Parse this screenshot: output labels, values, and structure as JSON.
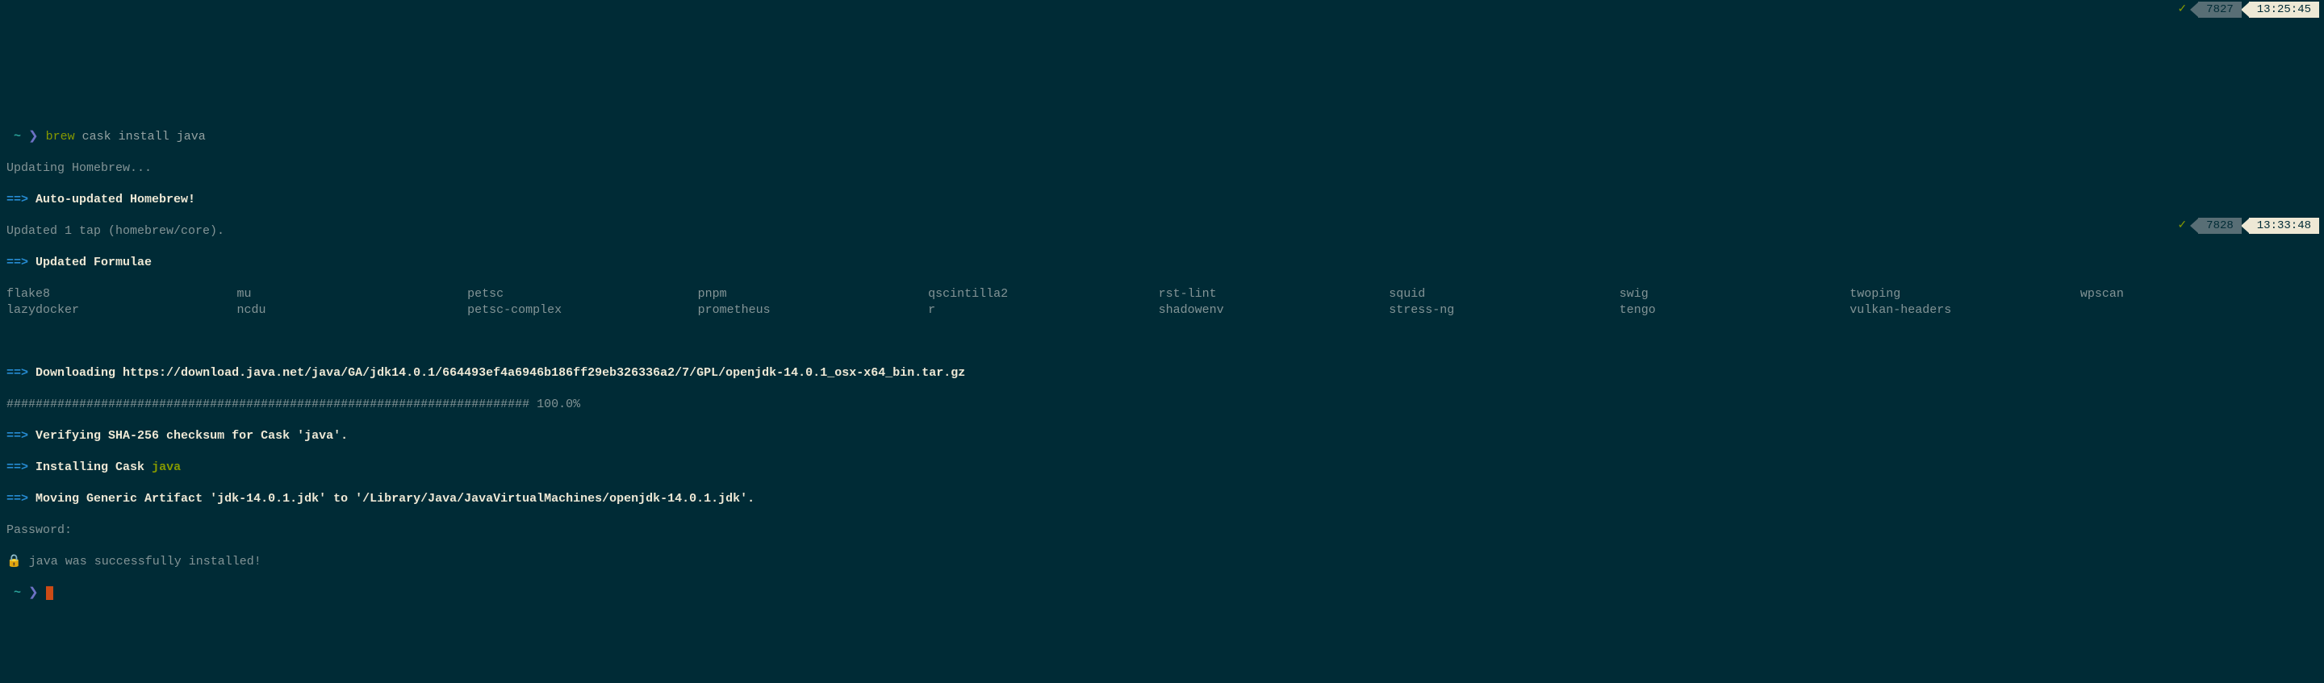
{
  "status_bars": [
    {
      "check": "✓",
      "num": "7827",
      "time": "13:25:45"
    },
    {
      "check": "✓",
      "num": "7828",
      "time": "13:33:48"
    }
  ],
  "prompt1": {
    "tilde": "~",
    "arrow": "❯",
    "cmd_green": "brew",
    "cmd_rest": "cask install java"
  },
  "lines": {
    "updating": "Updating Homebrew...",
    "arrow": "==>",
    "auto_updated": "Auto-updated Homebrew!",
    "updated_tap": "Updated 1 tap (homebrew/core).",
    "updated_formulae": "Updated Formulae",
    "downloading": "Downloading https://download.java.net/java/GA/jdk14.0.1/664493ef4a6946b186ff29eb326336a2/7/GPL/openjdk-14.0.1_osx-x64_bin.tar.gz",
    "progress": "######################################################################## 100.0%",
    "verifying": "Verifying SHA-256 checksum for Cask 'java'.",
    "installing_prefix": "Installing Cask ",
    "installing_name": "java",
    "moving": "Moving Generic Artifact 'jdk-14.0.1.jdk' to '/Library/Java/JavaVirtualMachines/openjdk-14.0.1.jdk'.",
    "password": "Password:",
    "lock": "🔒",
    "success": " java was successfully installed!"
  },
  "formulae": [
    [
      "flake8",
      "mu",
      "petsc",
      "pnpm",
      "qscintilla2",
      "rst-lint",
      "squid",
      "swig",
      "twoping",
      "wpscan"
    ],
    [
      "lazydocker",
      "ncdu",
      "petsc-complex",
      "prometheus",
      "r",
      "shadowenv",
      "stress-ng",
      "tengo",
      "vulkan-headers",
      ""
    ]
  ],
  "prompt2": {
    "tilde": "~",
    "arrow": "❯"
  }
}
